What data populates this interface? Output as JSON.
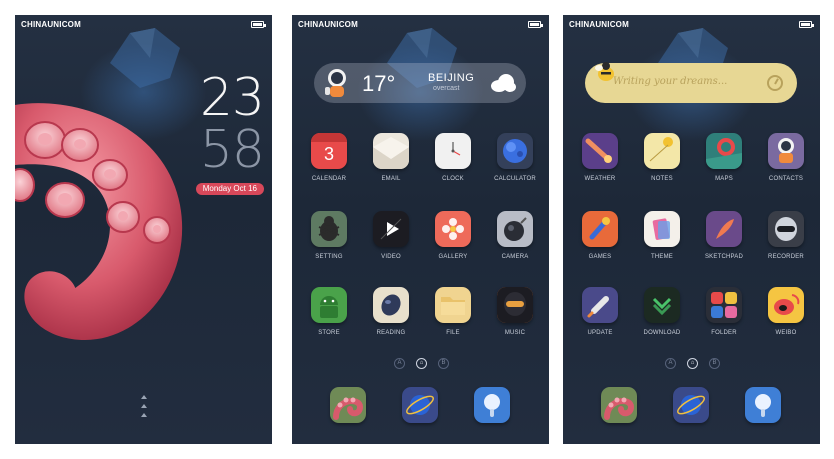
{
  "screens": [
    {
      "carrier": "CHINAUNICOM",
      "lock": {
        "hour": "23",
        "minute": "58",
        "date": "Monday  Oct 16"
      }
    },
    {
      "carrier": "CHINAUNICOM",
      "weather": {
        "temp": "17°",
        "city": "BEIJING",
        "condition": "overcast"
      },
      "apps": [
        "CALENDAR",
        "EMAIL",
        "CLOCK",
        "CALCULATOR",
        "SETTING",
        "VIDEO",
        "GALLERY",
        "CAMERA",
        "STORE",
        "READING",
        "FILE",
        "MUSIC"
      ],
      "calendar_day": "3",
      "page_dots": [
        "A",
        "⌂",
        "B"
      ]
    },
    {
      "carrier": "CHINAUNICOM",
      "notes": {
        "placeholder": "Writing your dreams..."
      },
      "apps": [
        "WEATHER",
        "NOTES",
        "MAPS",
        "CONTACTS",
        "GAMES",
        "THEME",
        "SKETCHPAD",
        "RECORDER",
        "UPDATE",
        "DOWNLOAD",
        "FOLDER",
        "WEIBO"
      ],
      "page_dots": [
        "A",
        "⌂",
        "B"
      ]
    }
  ],
  "dock": [
    "octopus",
    "browser",
    "search"
  ],
  "colors": {
    "bg_top": "#243042",
    "accent_red": "#d8485a",
    "notes_yellow": "#e7d794"
  }
}
